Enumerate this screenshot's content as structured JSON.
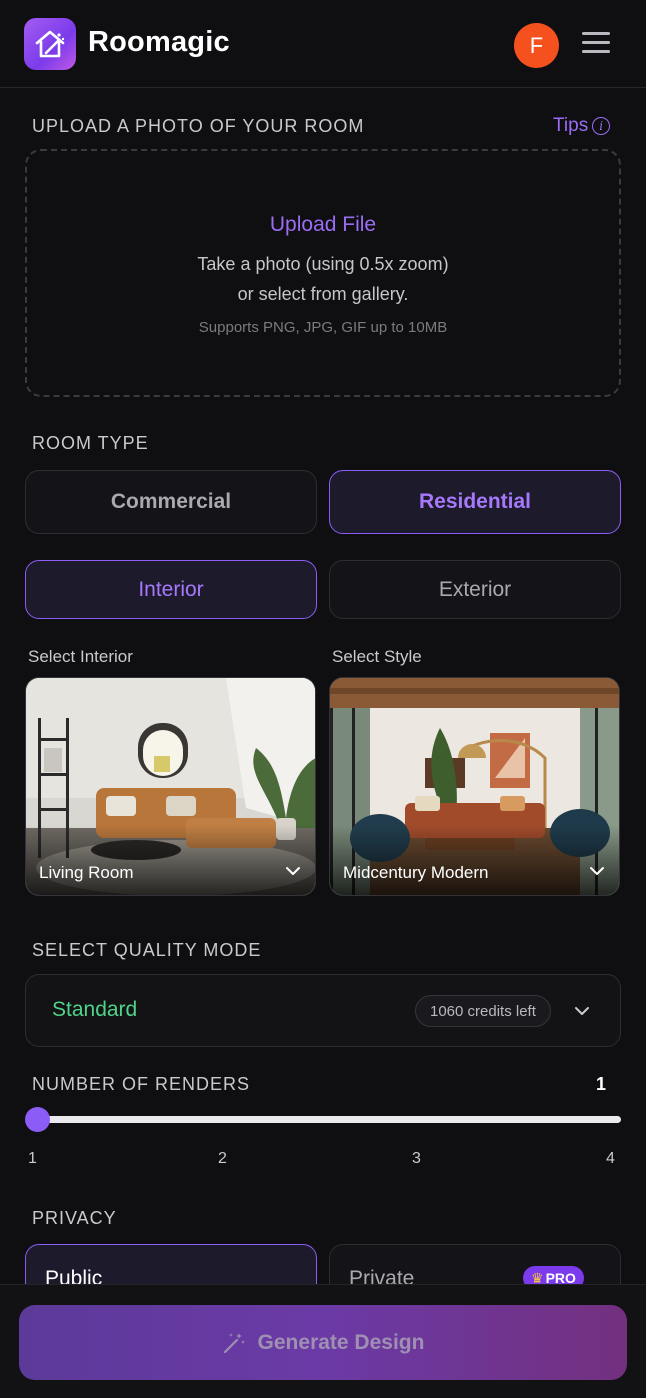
{
  "header": {
    "app_title": "Roomagic",
    "avatar_initial": "F",
    "logo_icon": "house-wand-icon",
    "menu_icon": "hamburger-menu-icon"
  },
  "upload": {
    "section_label": "UPLOAD A PHOTO OF YOUR ROOM",
    "tips_label": "Tips",
    "tips_icon": "info-icon",
    "title": "Upload File",
    "line1": "Take a photo (using 0.5x zoom)",
    "line2": "or select from gallery.",
    "note": "Supports PNG, JPG, GIF up to 10MB"
  },
  "room_type": {
    "section_label": "ROOM TYPE",
    "category_options": [
      "Commercial",
      "Residential"
    ],
    "selected_category": "Residential",
    "space_options": [
      "Interior",
      "Exterior"
    ],
    "selected_space": "Interior"
  },
  "selectors": {
    "interior_label": "Select Interior",
    "interior_value": "Living Room",
    "style_label": "Select Style",
    "style_value": "Midcentury Modern"
  },
  "quality": {
    "section_label": "SELECT QUALITY MODE",
    "value": "Standard",
    "credits": "1060 credits left",
    "accent_color": "#4fd38a"
  },
  "renders": {
    "section_label": "NUMBER OF RENDERS",
    "value": "1",
    "ticks": [
      "1",
      "2",
      "3",
      "4"
    ],
    "fraction": 0
  },
  "privacy": {
    "section_label": "PRIVACY",
    "public_label": "Public",
    "private_label": "Private",
    "pro_badge": "PRO",
    "selected": "Public"
  },
  "footer": {
    "generate_label": "Generate Design",
    "generate_icon": "magic-wand-icon"
  },
  "colors": {
    "accent": "#8b5cf6",
    "background": "#0f0f11",
    "avatar": "#f4511e"
  }
}
